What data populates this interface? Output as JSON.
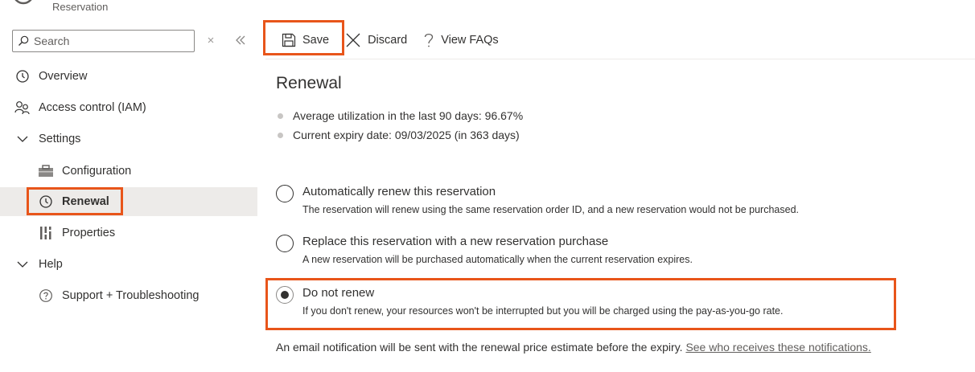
{
  "header": {
    "subtitle": "Reservation"
  },
  "sidebar": {
    "search": {
      "placeholder": "Search",
      "value": ""
    },
    "collapse_icon": "double-chevron-left",
    "clear_icon": "close",
    "items": [
      {
        "label": "Overview",
        "icon": "clock"
      },
      {
        "label": "Access control (IAM)",
        "icon": "people"
      },
      {
        "label": "Settings",
        "icon": "chevron-down"
      },
      {
        "label": "Configuration",
        "icon": "toolbox"
      },
      {
        "label": "Renewal",
        "icon": "clock",
        "active": true
      },
      {
        "label": "Properties",
        "icon": "bars"
      },
      {
        "label": "Help",
        "icon": "chevron-down"
      },
      {
        "label": "Support + Troubleshooting",
        "icon": "question-circle"
      }
    ]
  },
  "toolbar": {
    "save_label": "Save",
    "discard_label": "Discard",
    "faq_label": "View FAQs"
  },
  "main": {
    "title": "Renewal",
    "bullets": [
      "Average utilization in the last 90 days: 96.67%",
      "Current expiry date: 09/03/2025 (in 363 days)"
    ],
    "options": [
      {
        "label": "Automatically renew this reservation",
        "description": "The reservation will renew using the same reservation order ID, and a new reservation would not be purchased.",
        "selected": false
      },
      {
        "label": "Replace this reservation with a new reservation purchase",
        "description": "A new reservation will be purchased automatically when the current reservation expires.",
        "selected": false
      },
      {
        "label": "Do not renew",
        "description": "If you don't renew, your resources won't be interrupted but you will be charged using the pay-as-you-go rate.",
        "selected": true
      }
    ],
    "footer_text": "An email notification will be sent with the renewal price estimate before the expiry.",
    "footer_link": "See who receives these notifications."
  },
  "colors": {
    "highlight": "#e8551a",
    "active_bg": "#edebe9",
    "text": "#323130"
  }
}
